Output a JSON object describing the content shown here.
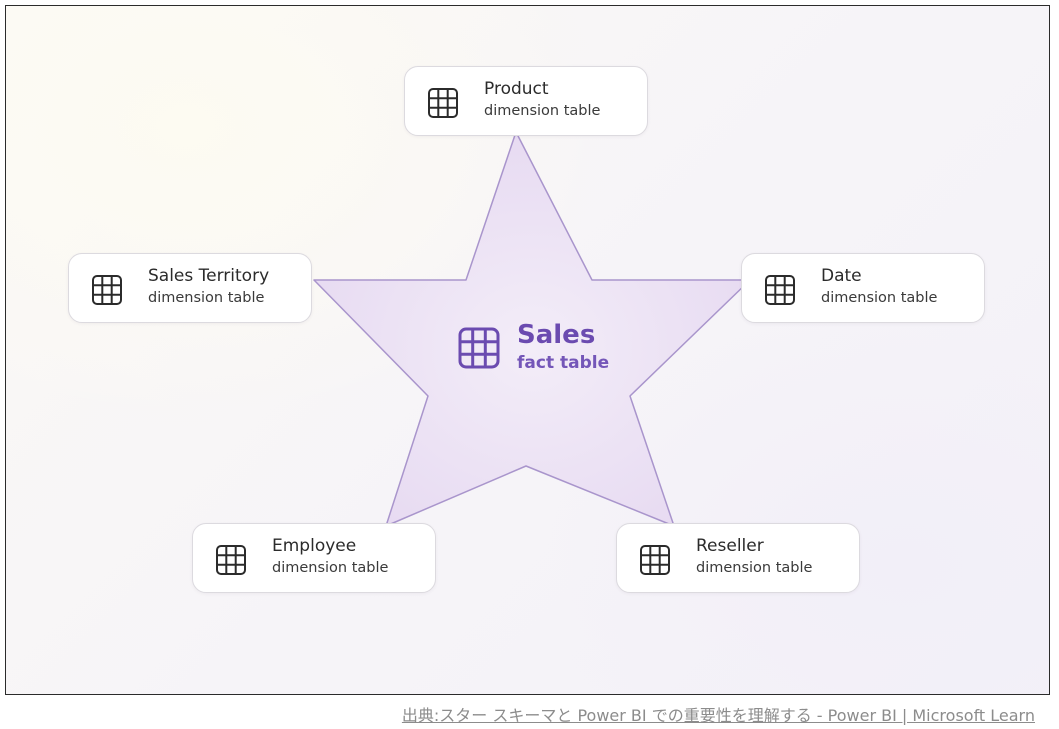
{
  "fact": {
    "title": "Sales",
    "subtitle": "fact table",
    "icon": "table-grid-icon",
    "color": "#6b4bb0"
  },
  "dimensions": [
    {
      "id": "product",
      "title": "Product",
      "subtitle": "dimension table",
      "icon": "table-grid-icon"
    },
    {
      "id": "sales-territory",
      "title": "Sales Territory",
      "subtitle": "dimension table",
      "icon": "table-grid-icon"
    },
    {
      "id": "date",
      "title": "Date",
      "subtitle": "dimension table",
      "icon": "table-grid-icon"
    },
    {
      "id": "employee",
      "title": "Employee",
      "subtitle": "dimension table",
      "icon": "table-grid-icon"
    },
    {
      "id": "reseller",
      "title": "Reseller",
      "subtitle": "dimension table",
      "icon": "table-grid-icon"
    }
  ],
  "source_caption": "出典:スター スキーマと Power BI での重要性を理解する - Power BI | Microsoft Learn",
  "colors": {
    "star_fill": "#e9def3",
    "star_stroke": "#a995cc",
    "card_border": "#dcdadf",
    "text": "#2b2b2b"
  }
}
